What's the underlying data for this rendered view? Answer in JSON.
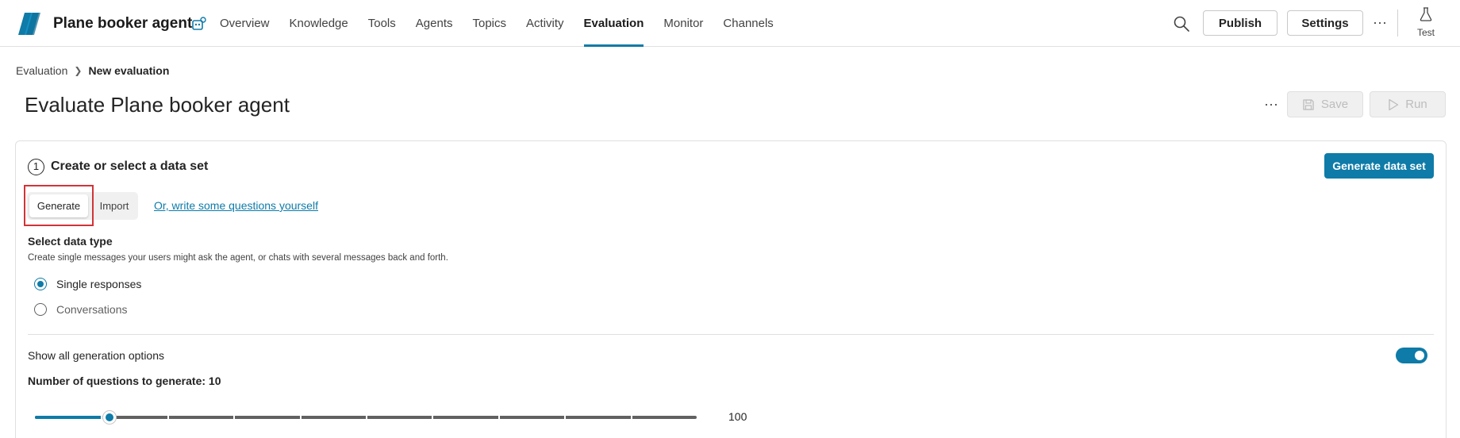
{
  "app": {
    "agent_name": "Plane booker agent"
  },
  "nav": {
    "items": [
      {
        "label": "Overview",
        "active": false
      },
      {
        "label": "Knowledge",
        "active": false
      },
      {
        "label": "Tools",
        "active": false
      },
      {
        "label": "Agents",
        "active": false
      },
      {
        "label": "Topics",
        "active": false
      },
      {
        "label": "Activity",
        "active": false
      },
      {
        "label": "Evaluation",
        "active": true
      },
      {
        "label": "Monitor",
        "active": false
      },
      {
        "label": "Channels",
        "active": false
      }
    ]
  },
  "header": {
    "publish_label": "Publish",
    "settings_label": "Settings",
    "more_label": "···",
    "test_label": "Test"
  },
  "breadcrumb": {
    "parent": "Evaluation",
    "current": "New evaluation"
  },
  "page": {
    "title": "Evaluate Plane booker agent",
    "more_label": "···",
    "save_label": "Save",
    "run_label": "Run"
  },
  "step": {
    "number": "1",
    "title": "Create or select a data set",
    "generate_dataset_label": "Generate data set",
    "tabs": {
      "generate": "Generate",
      "import": "Import"
    },
    "write_link": "Or, write some questions yourself",
    "data_type_label": "Select data type",
    "data_type_desc": "Create single messages your users might ask the agent, or chats with several messages back and forth.",
    "options": [
      {
        "label": "Single responses",
        "selected": true
      },
      {
        "label": "Conversations",
        "selected": false
      }
    ],
    "show_options_label": "Show all generation options",
    "show_options_on": true,
    "questions_label": "Number of questions to generate: 10",
    "slider": {
      "value": 10,
      "max": 100,
      "max_label": "100",
      "steps": 10
    }
  },
  "colors": {
    "accent": "#0e7ba8",
    "highlight": "#d13438"
  }
}
